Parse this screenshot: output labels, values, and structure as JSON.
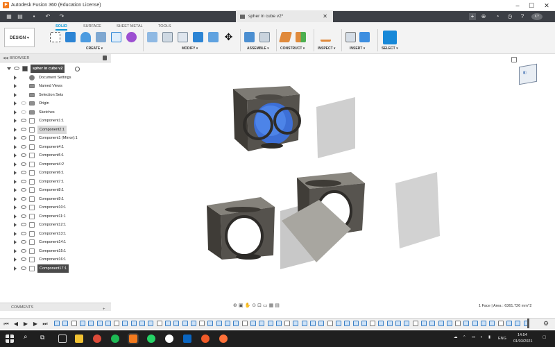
{
  "window": {
    "title": "Autodesk Fusion 360 (Education License)",
    "min": "–",
    "max": "☐",
    "close": "✕"
  },
  "doc_tab": {
    "title": "spher in cube v2*",
    "close": "✕",
    "add": "+"
  },
  "ribbon": {
    "design_label": "DESIGN ▾",
    "tabs": [
      "SOLID",
      "SURFACE",
      "SHEET METAL",
      "TOOLS"
    ],
    "groups": [
      "CREATE ▾",
      "MODIFY ▾",
      "ASSEMBLE ▾",
      "CONSTRUCT ▾",
      "INSPECT ▾",
      "INSERT ▾",
      "SELECT ▾"
    ]
  },
  "browser": {
    "title": "BROWSER",
    "root": "spher in cube v2",
    "items": [
      {
        "label": "Document Settings",
        "icon": "gear-icon"
      },
      {
        "label": "Named Views",
        "icon": "folder-icon"
      },
      {
        "label": "Selection Sets",
        "icon": "folder-icon"
      },
      {
        "label": "Origin",
        "icon": "folder-icon"
      },
      {
        "label": "Sketches",
        "icon": "folder-icon"
      },
      {
        "label": "Component1:1",
        "icon": "component-icon"
      },
      {
        "label": "Component2:1",
        "icon": "component-icon"
      },
      {
        "label": "Component1 (Mirror):1",
        "icon": "component-icon"
      },
      {
        "label": "Component4:1",
        "icon": "component-icon"
      },
      {
        "label": "Component5:1",
        "icon": "component-icon"
      },
      {
        "label": "Component4:2",
        "icon": "component-icon"
      },
      {
        "label": "Component6:1",
        "icon": "component-icon"
      },
      {
        "label": "Component7:1",
        "icon": "component-icon"
      },
      {
        "label": "Component8:1",
        "icon": "component-icon"
      },
      {
        "label": "Component9:1",
        "icon": "component-icon"
      },
      {
        "label": "Component10:1",
        "icon": "component-icon"
      },
      {
        "label": "Component11:1",
        "icon": "component-icon"
      },
      {
        "label": "Component12:1",
        "icon": "component-icon"
      },
      {
        "label": "Component13:1",
        "icon": "component-icon"
      },
      {
        "label": "Component14:1",
        "icon": "component-icon"
      },
      {
        "label": "Component15:1",
        "icon": "component-icon"
      },
      {
        "label": "Component16:1",
        "icon": "component-icon"
      },
      {
        "label": "Component17:1",
        "icon": "component-icon"
      }
    ]
  },
  "comments": {
    "title": "COMMENTS"
  },
  "status": {
    "text": "1 Face | Area : 6361.726 mm^2"
  },
  "taskbar": {
    "lang": "ENG",
    "time": "14:54",
    "date": "01/03/2021"
  },
  "colors": {
    "accent": "#0696d7",
    "dark_bar": "#3c3f45",
    "sphere": "#3d6fd6",
    "body": "#55524d"
  }
}
